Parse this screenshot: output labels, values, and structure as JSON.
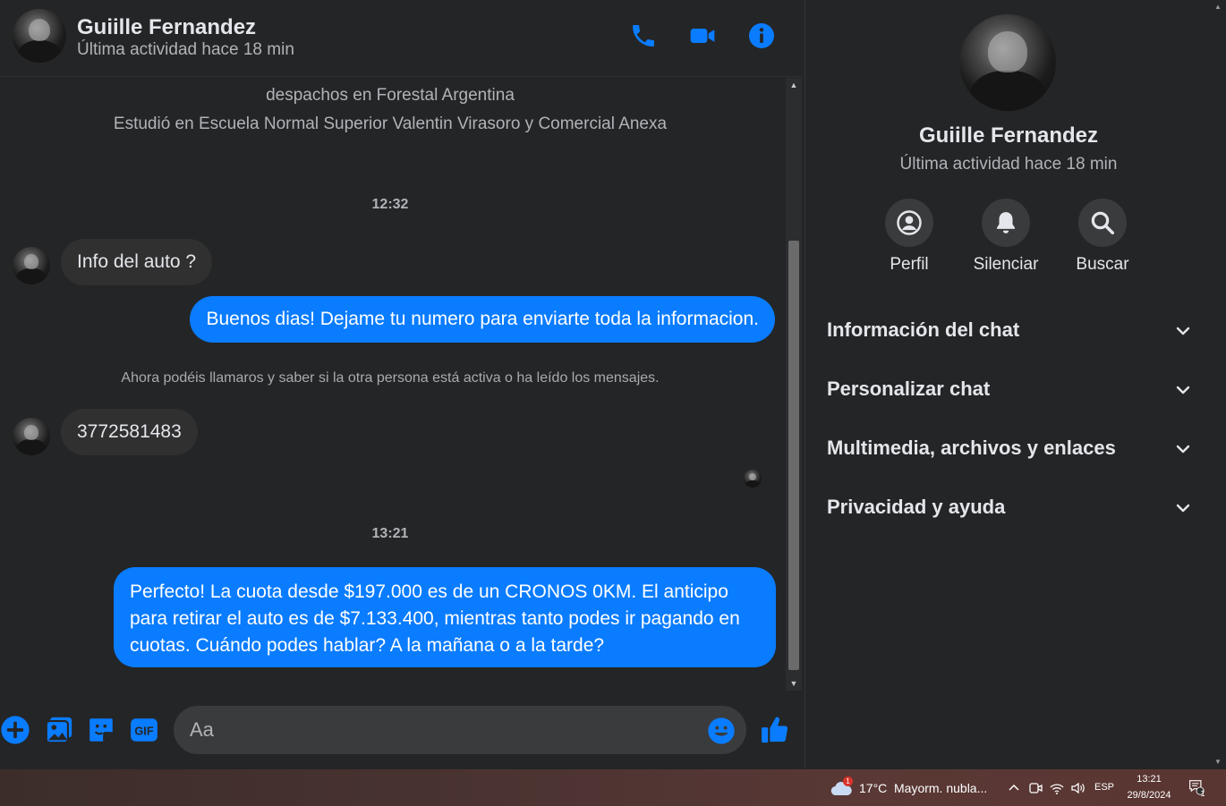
{
  "header": {
    "name": "Guiille Fernandez",
    "status": "Última actividad hace 18 min"
  },
  "thread": {
    "info_line_1": "despachos en Forestal Argentina",
    "info_line_2": "Estudió en Escuela Normal Superior Valentin Virasoro y Comercial Anexa",
    "time_1": "12:32",
    "messages": [
      {
        "direction": "in",
        "text": "Info del auto ?"
      },
      {
        "direction": "out",
        "text": "Buenos dias! Dejame tu numero para enviarte toda la informacion."
      },
      {
        "direction": "in",
        "text": "3772581483"
      },
      {
        "direction": "out",
        "text": "Perfecto! La cuota desde $197.000 es de un CRONOS 0KM. El anticipo para retirar el auto es de $7.133.400, mientras tanto podes ir pagando en cuotas. Cuándo podes hablar? A la mañana o a la tarde?"
      }
    ],
    "notice": "Ahora podéis llamaros y saber si la otra persona está activa o ha leído los mensajes.",
    "time_2": "13:21"
  },
  "composer": {
    "placeholder": "Aa"
  },
  "panel": {
    "name": "Guiille Fernandez",
    "status": "Última actividad hace 18 min",
    "actions": [
      {
        "label": "Perfil",
        "icon": "profile-icon"
      },
      {
        "label": "Silenciar",
        "icon": "bell-icon"
      },
      {
        "label": "Buscar",
        "icon": "search-icon"
      }
    ],
    "sections": [
      {
        "label": "Información del chat"
      },
      {
        "label": "Personalizar chat"
      },
      {
        "label": "Multimedia, archivos y enlaces"
      },
      {
        "label": "Privacidad y ayuda"
      }
    ]
  },
  "taskbar": {
    "weather_badge": "1",
    "weather_temp": "17°C",
    "weather_desc": "Mayorm. nubla...",
    "language": "ESP",
    "clock_time": "13:21",
    "clock_date": "29/8/2024",
    "notification_count": "1"
  },
  "colors": {
    "accent": "#0a7cff",
    "background": "#242526",
    "incoming_bubble": "#303030",
    "secondary_text": "#b0b3b8"
  }
}
